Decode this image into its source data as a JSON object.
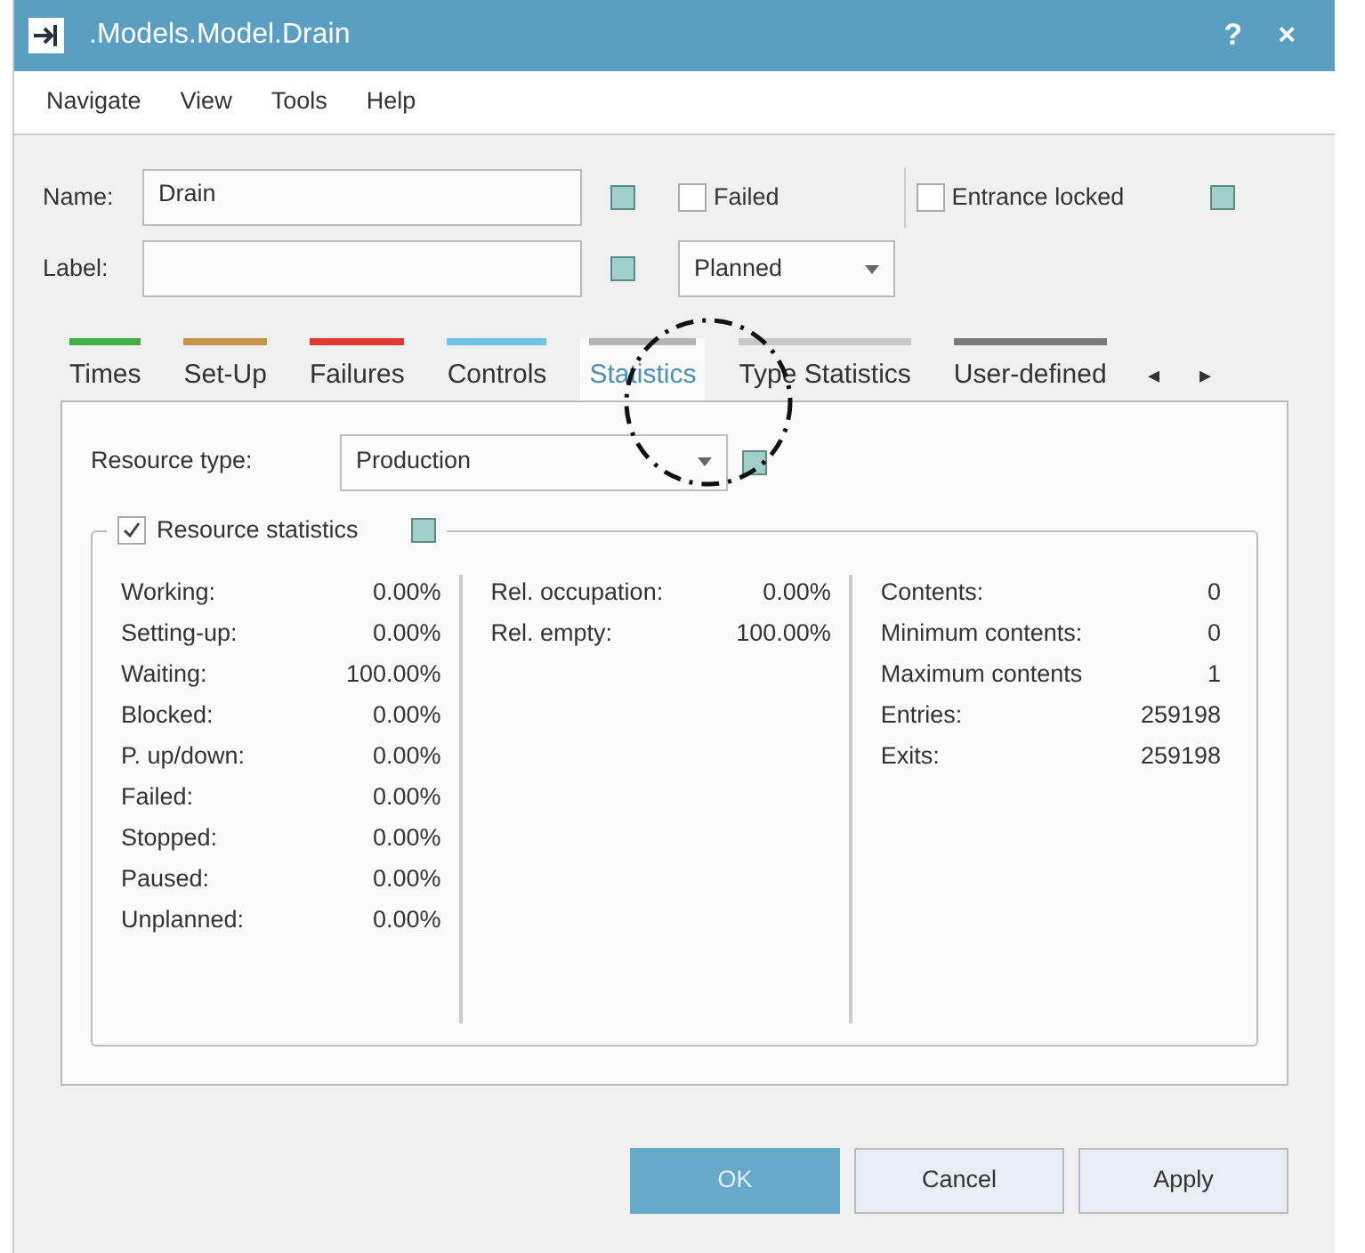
{
  "window": {
    "title": ".Models.Model.Drain",
    "help": "?",
    "close": "×"
  },
  "menu": [
    "Navigate",
    "View",
    "Tools",
    "Help"
  ],
  "name_field": {
    "label": "Name:",
    "value": "Drain"
  },
  "label_field": {
    "label": "Label:"
  },
  "failed": {
    "label": "Failed",
    "checked": false
  },
  "entrance_locked": {
    "label": "Entrance locked",
    "checked": false
  },
  "planned": {
    "value": "Planned"
  },
  "tabs": [
    {
      "label": "Times",
      "color": "#3cb043",
      "selected": false
    },
    {
      "label": "Set-Up",
      "color": "#c8964b",
      "selected": false
    },
    {
      "label": "Failures",
      "color": "#e03a2f",
      "selected": false
    },
    {
      "label": "Controls",
      "color": "#6ec3e8",
      "selected": false
    },
    {
      "label": "Statistics",
      "color": "#b4b4b4",
      "selected": true
    },
    {
      "label": "Type Statistics",
      "color": "#c8c8c8",
      "selected": false
    },
    {
      "label": "User-defined",
      "color": "#7a7a7a",
      "selected": false
    }
  ],
  "tab_scroll": [
    "◂",
    "▸"
  ],
  "resource_type": {
    "label": "Resource type:",
    "value": "Production"
  },
  "resource_statistics": {
    "label": "Resource statistics",
    "checked": true
  },
  "stat_columns": [
    [
      {
        "label": "Working:",
        "value": "0.00%"
      },
      {
        "label": "Setting-up:",
        "value": "0.00%"
      },
      {
        "label": "Waiting:",
        "value": "100.00%"
      },
      {
        "label": "Blocked:",
        "value": "0.00%"
      },
      {
        "label": "P. up/down:",
        "value": "0.00%"
      },
      {
        "label": "Failed:",
        "value": "0.00%"
      },
      {
        "label": "Stopped:",
        "value": "0.00%"
      },
      {
        "label": "Paused:",
        "value": "0.00%"
      },
      {
        "label": "Unplanned:",
        "value": "0.00%"
      }
    ],
    [
      {
        "label": "Rel. occupation:",
        "value": "0.00%"
      },
      {
        "label": "Rel. empty:",
        "value": "100.00%"
      }
    ],
    [
      {
        "label": "Contents:",
        "value": "0"
      },
      {
        "label": "Minimum contents:",
        "value": "0"
      },
      {
        "label": "Maximum contents",
        "value": "1"
      },
      {
        "label": "Entries:",
        "value": "259198"
      },
      {
        "label": "Exits:",
        "value": "259198"
      }
    ]
  ],
  "buttons": [
    {
      "label": "OK",
      "kind": "primary"
    },
    {
      "label": "Cancel",
      "kind": "normal"
    },
    {
      "label": "Apply",
      "kind": "normal"
    }
  ]
}
